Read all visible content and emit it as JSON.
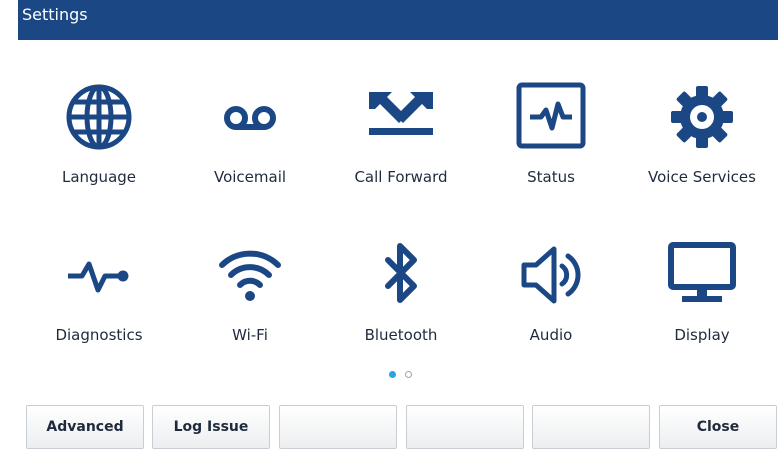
{
  "header": {
    "title": "Settings"
  },
  "colors": {
    "titlebar": "#1c4785",
    "icon": "#1c4785",
    "page_active": "#2aa3df"
  },
  "grid": {
    "items": [
      {
        "label": "Language",
        "icon": "globe-icon"
      },
      {
        "label": "Voicemail",
        "icon": "voicemail-icon"
      },
      {
        "label": "Call Forward",
        "icon": "call-forward-icon"
      },
      {
        "label": "Status",
        "icon": "status-monitor-icon"
      },
      {
        "label": "Voice Services",
        "icon": "gear-icon"
      },
      {
        "label": "Diagnostics",
        "icon": "pulse-icon"
      },
      {
        "label": "Wi-Fi",
        "icon": "wifi-icon"
      },
      {
        "label": "Bluetooth",
        "icon": "bluetooth-icon"
      },
      {
        "label": "Audio",
        "icon": "speaker-icon"
      },
      {
        "label": "Display",
        "icon": "monitor-icon"
      }
    ]
  },
  "pagination": {
    "current": 1,
    "total": 2
  },
  "softkeys": [
    "Advanced",
    "Log Issue",
    "",
    "",
    "",
    "Close"
  ]
}
